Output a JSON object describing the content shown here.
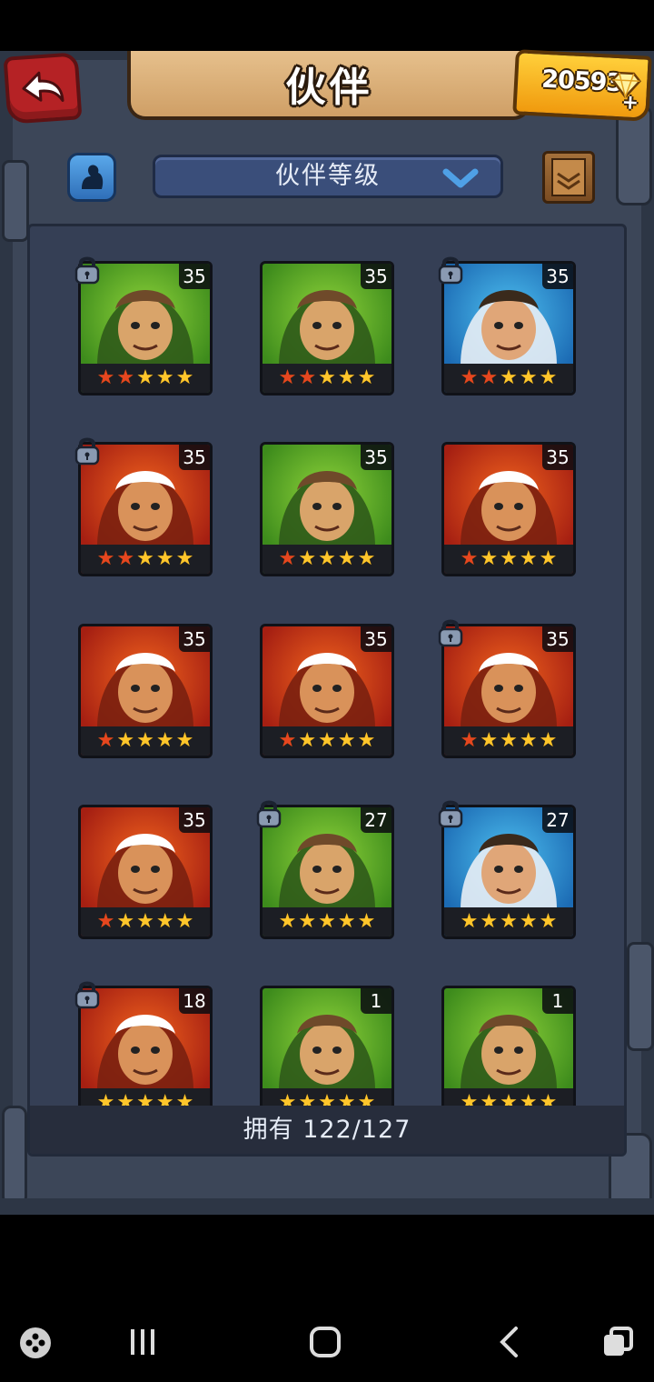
{
  "header": {
    "title": "伙伴",
    "gems": "20593",
    "gems_plus": "+"
  },
  "toolbar": {
    "sort_label": "伙伴等级"
  },
  "roster": [
    {
      "level": "35",
      "bg": "green",
      "locked": true,
      "stars": 5,
      "red_stars": 2
    },
    {
      "level": "35",
      "bg": "green",
      "locked": false,
      "stars": 5,
      "red_stars": 2
    },
    {
      "level": "35",
      "bg": "blue",
      "locked": true,
      "stars": 5,
      "red_stars": 2
    },
    {
      "level": "35",
      "bg": "red",
      "locked": true,
      "stars": 5,
      "red_stars": 2
    },
    {
      "level": "35",
      "bg": "green",
      "locked": false,
      "stars": 5,
      "red_stars": 1
    },
    {
      "level": "35",
      "bg": "red",
      "locked": false,
      "stars": 5,
      "red_stars": 1
    },
    {
      "level": "35",
      "bg": "red",
      "locked": false,
      "stars": 5,
      "red_stars": 1
    },
    {
      "level": "35",
      "bg": "red",
      "locked": false,
      "stars": 5,
      "red_stars": 1
    },
    {
      "level": "35",
      "bg": "red",
      "locked": true,
      "stars": 5,
      "red_stars": 1
    },
    {
      "level": "35",
      "bg": "red",
      "locked": false,
      "stars": 5,
      "red_stars": 1
    },
    {
      "level": "27",
      "bg": "green",
      "locked": true,
      "stars": 5,
      "red_stars": 0
    },
    {
      "level": "27",
      "bg": "blue",
      "locked": true,
      "stars": 5,
      "red_stars": 0
    },
    {
      "level": "18",
      "bg": "red",
      "locked": true,
      "stars": 5,
      "red_stars": 0
    },
    {
      "level": "1",
      "bg": "green",
      "locked": false,
      "stars": 5,
      "red_stars": 0
    },
    {
      "level": "1",
      "bg": "green",
      "locked": false,
      "stars": 5,
      "red_stars": 0
    }
  ],
  "footer": {
    "owned_text": "拥有 122/127"
  },
  "colors": {
    "frame": "#3c4658",
    "panel": "#353f55",
    "back_button": "#b52225",
    "gem_panel": "#f6b623",
    "star_gold": "#ffc62b",
    "star_red": "#e6461f"
  }
}
